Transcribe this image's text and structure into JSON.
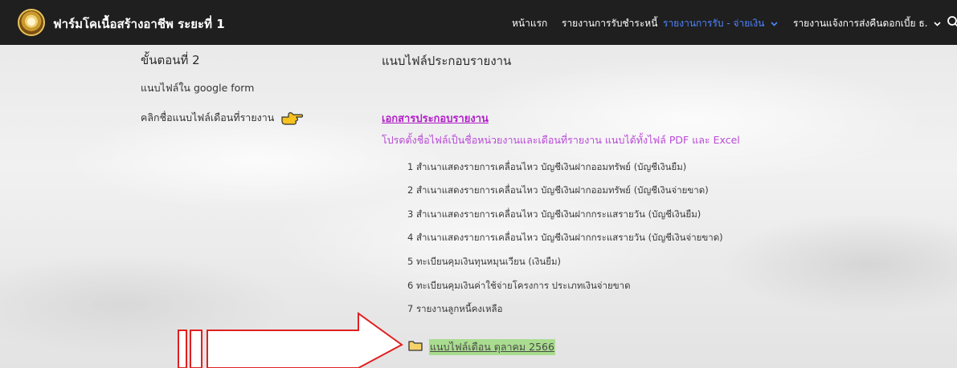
{
  "header": {
    "site_title": "ฟาร์มโคเนื้อสร้างอาชีพ ระยะที่ 1",
    "nav": [
      {
        "label": "หน้าแรก"
      },
      {
        "label": "รายงานการรับชำระหนี้"
      },
      {
        "label": "รายงานการรับ - จ่ายเงิน",
        "active": true,
        "dropdown": true
      },
      {
        "label": "รายงานแจ้งการส่งคืนดอกเบี้ย ธ.",
        "dropdown": true
      }
    ],
    "search_icon": "search-icon",
    "accent_color": "#4f86ff"
  },
  "left": {
    "step_title": "ขั้นตอนที่ 2",
    "attach_text": "แนบไฟล์ใน google form",
    "click_text": "คลิกชื่อแนบไฟล์เดือนที่รายงาน",
    "hand_icon": "pointing-hand-icon"
  },
  "main": {
    "section_title": "แนบไฟล์ประกอบรายงาน",
    "doc_link": "เอกสารประกอบรายงาน",
    "note": "โปรดตั้งชื่อไฟล์เป็นชื่อหน่วยงานและเดือนที่รายงาน แนบได้ทั้งไฟล์ PDF และ Excel",
    "items": [
      "1 สำเนาแสดงรายการเคลื่อนไหว บัญชีเงินฝากออมทรัพย์ (บัญชีเงินยืม)",
      "2 สำเนาแสดงรายการเคลื่อนไหว บัญชีเงินฝากออมทรัพย์ (บัญชีเงินจ่ายขาด)",
      "3 สำเนาแสดงรายการเคลื่อนไหว บัญชีเงินฝากกระแสรายวัน (บัญชีเงินยืม)",
      "4 สำเนาแสดงรายการเคลื่อนไหว บัญชีเงินฝากกระแสรายวัน (บัญชีเงินจ่ายขาด)",
      "5 ทะเบียนคุมเงินทุนหมุนเวียน (เงินยืม)",
      "6 ทะเบียนคุมเงินค่าใช้จ่ายโครงการ ประเภทเงินจ่ายขาด",
      "7 รายงานลูกหนี้คงเหลือ"
    ],
    "file_link": "แนบไฟล์เดือน ตุลาคม 2566",
    "folder_icon": "folder-icon",
    "link_color": "#b01fc7",
    "highlight_color": "#a9dc8f",
    "arrow_color": "#e02020"
  }
}
